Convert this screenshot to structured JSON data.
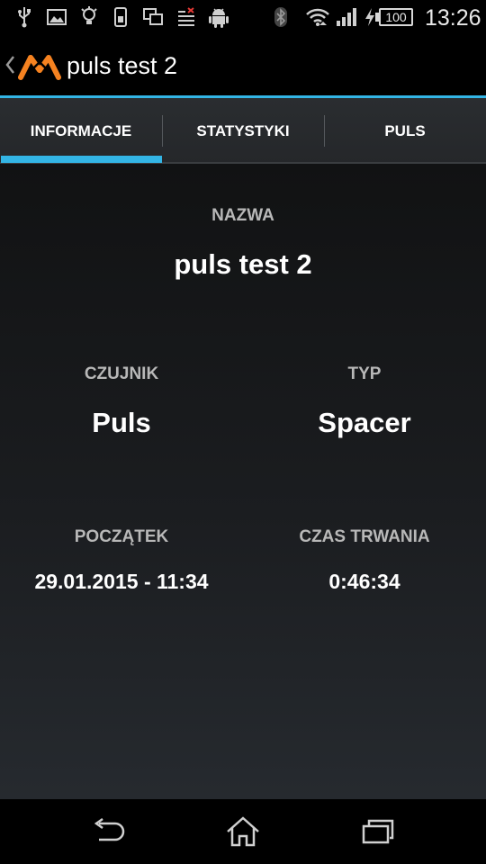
{
  "status_bar": {
    "icons": [
      "usb-icon",
      "image-icon",
      "bulb-icon",
      "phone-icon",
      "screens-icon",
      "notification-x-icon",
      "android-icon",
      "bluetooth-icon",
      "wifi-icon",
      "signal-icon",
      "charging-icon"
    ],
    "battery": "100",
    "time": "13:26"
  },
  "action_bar": {
    "title": "puls test 2",
    "logo_color": "#f58220",
    "accent": "#33b5e5"
  },
  "tabs": [
    {
      "label": "INFORMACJE",
      "selected": true
    },
    {
      "label": "STATYSTYKI",
      "selected": false
    },
    {
      "label": "PULS",
      "selected": false
    }
  ],
  "info": {
    "name_label": "NAZWA",
    "name_value": "puls test 2",
    "sensor_label": "CZUJNIK",
    "sensor_value": "Puls",
    "type_label": "TYP",
    "type_value": "Spacer",
    "start_label": "POCZĄTEK",
    "start_value": "29.01.2015 - 11:34",
    "duration_label": "CZAS TRWANIA",
    "duration_value": "0:46:34"
  },
  "nav_bar": {
    "buttons": [
      "back-icon",
      "home-icon",
      "recents-icon"
    ]
  }
}
